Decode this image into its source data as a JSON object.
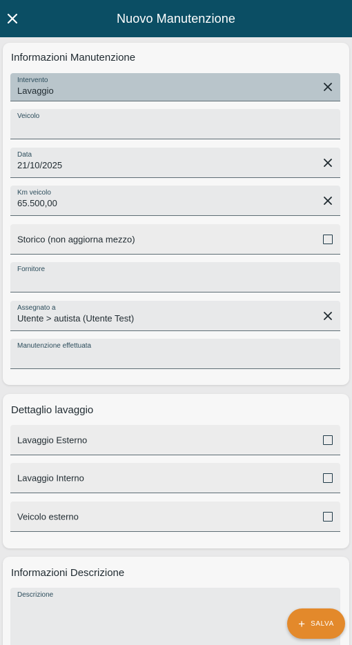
{
  "appbar": {
    "title": "Nuovo Manutenzione",
    "close_icon": "close-icon"
  },
  "info_card": {
    "title": "Informazioni Manutenzione",
    "fields": {
      "intervento": {
        "label": "Intervento",
        "value": "Lavaggio"
      },
      "veicolo": {
        "label": "Veicolo",
        "value": ""
      },
      "data": {
        "label": "Data",
        "value": "21/10/2025"
      },
      "km": {
        "label": "Km veicolo",
        "value": "65.500,00"
      },
      "storico": {
        "label": "Storico (non aggiorna mezzo)",
        "checked": false
      },
      "fornitore": {
        "label": "Fornitore",
        "value": ""
      },
      "assegnato": {
        "label": "Assegnato a",
        "value": "Utente > autista (Utente Test)"
      },
      "effettuata": {
        "label": "Manutenzione effettuata",
        "value": ""
      }
    }
  },
  "wash_card": {
    "title": "Dettaglio lavaggio",
    "items": [
      {
        "label": "Lavaggio Esterno",
        "checked": false
      },
      {
        "label": "Lavaggio Interno",
        "checked": false
      },
      {
        "label": "Veicolo esterno",
        "checked": false
      }
    ]
  },
  "desc_card": {
    "title": "Informazioni Descrizione",
    "field": {
      "label": "Descrizione",
      "value": ""
    }
  },
  "fab": {
    "label": "SALVA",
    "icon": "plus-icon"
  },
  "colors": {
    "appbar": "#0b4e64",
    "accent": "#e3892b",
    "filled_field": "#b9c5cb"
  }
}
